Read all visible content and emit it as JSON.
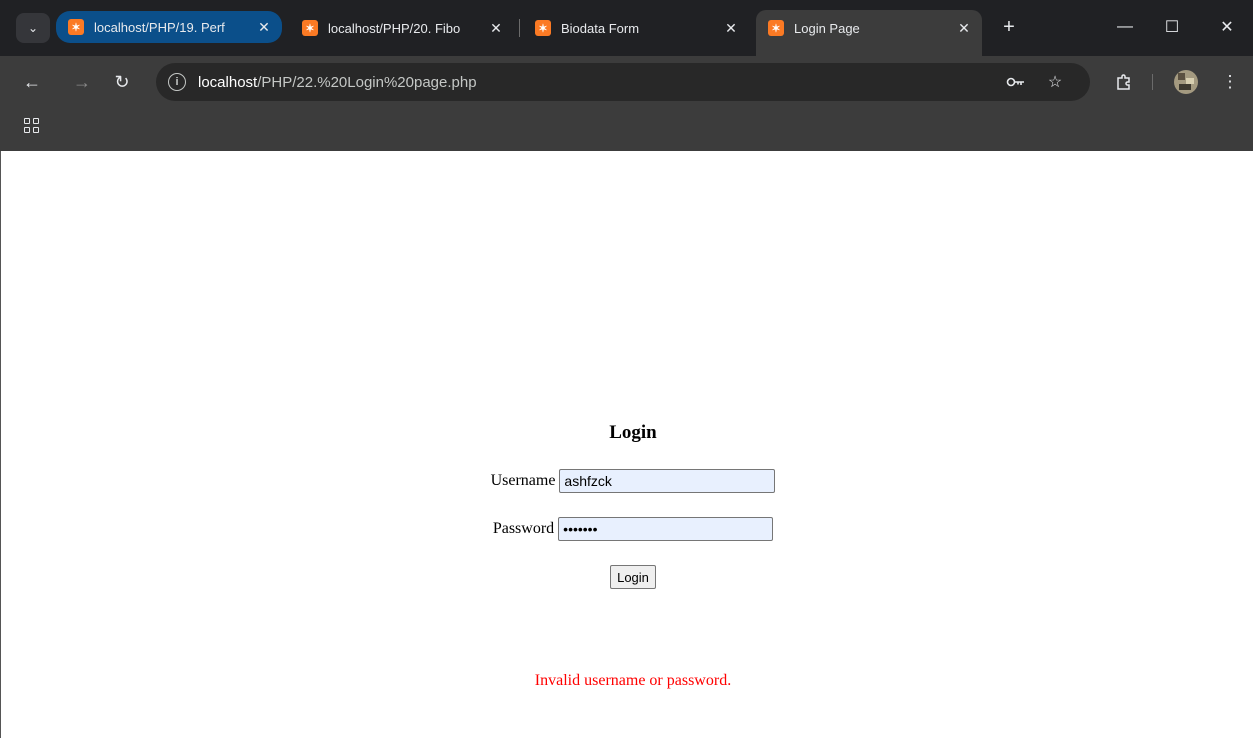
{
  "browser": {
    "tabs": [
      {
        "title": "localhost/PHP/19. Perf",
        "close": "✕"
      },
      {
        "title": "localhost/PHP/20. Fibo",
        "close": "✕"
      },
      {
        "title": "Biodata Form",
        "close": "✕"
      },
      {
        "title": "Login Page",
        "close": "✕"
      }
    ],
    "favicon_letter": "✶",
    "new_tab": "+",
    "window_controls": {
      "minimize": "—",
      "maximize": "☐",
      "close": "✕"
    },
    "url_host": "localhost",
    "url_path": "/PHP/22.%20Login%20page.php"
  },
  "page": {
    "title": "Login",
    "username_label": "Username",
    "username_value": "ashfzck",
    "password_label": "Password",
    "password_value": "1234567",
    "login_button": "Login",
    "error_message": "Invalid username or password."
  },
  "colors": {
    "error": "#ff0000",
    "xampp_orange": "#fb7a24",
    "group_blue": "#0b4f8a"
  }
}
